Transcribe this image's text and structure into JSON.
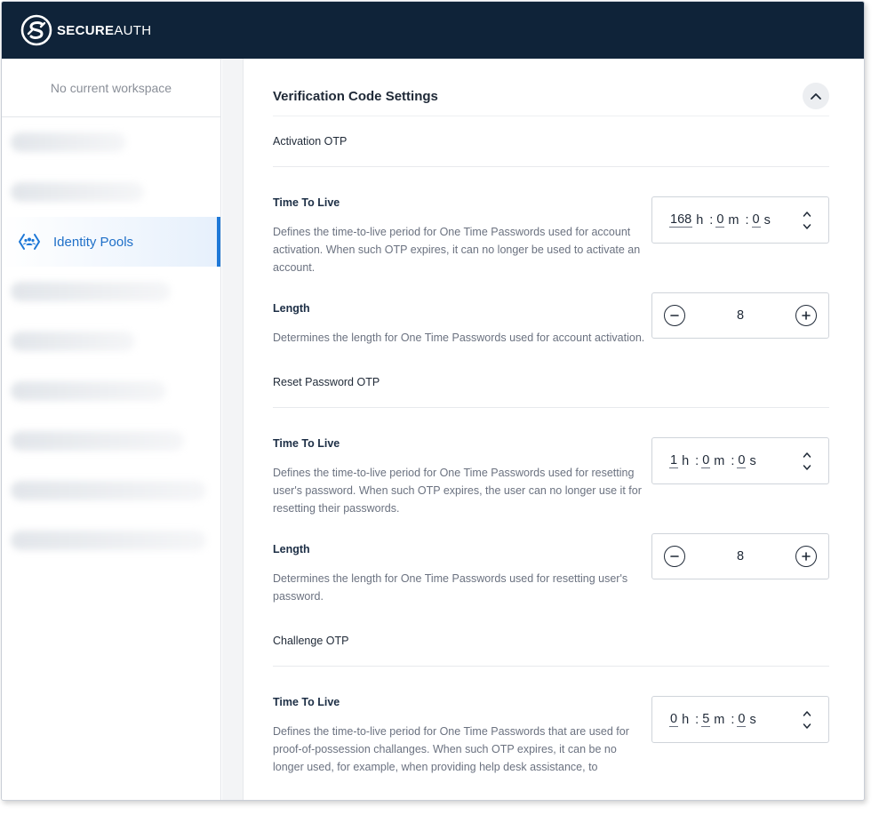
{
  "brand": {
    "bold": "SECURE",
    "light": "AUTH"
  },
  "sidebar": {
    "workspace": "No current workspace",
    "active_item": {
      "label": "Identity Pools",
      "icon": "identity-pools-icon"
    }
  },
  "panel": {
    "title": "Verification Code Settings",
    "sections": [
      {
        "title": "Activation OTP",
        "ttl": {
          "label": "Time To Live",
          "desc": "Defines the time-to-live period for One Time Passwords used for account activation. When such OTP expires, it can no longer be used to activate an account.",
          "h": "168",
          "m": "0",
          "s": "0"
        },
        "length": {
          "label": "Length",
          "desc": "Determines the length for One Time Passwords used for account activation.",
          "value": "8"
        }
      },
      {
        "title": "Reset Password OTP",
        "ttl": {
          "label": "Time To Live",
          "desc": "Defines the time-to-live period for One Time Passwords used for resetting user's password. When such OTP expires, the user can no longer use it for resetting their passwords.",
          "h": "1",
          "m": "0",
          "s": "0"
        },
        "length": {
          "label": "Length",
          "desc": "Determines the length for One Time Passwords used for resetting user's password.",
          "value": "8"
        }
      },
      {
        "title": "Challenge OTP",
        "ttl": {
          "label": "Time To Live",
          "desc": "Defines the time-to-live period for One Time Passwords that are used for proof-of-possession challanges. When such OTP expires, it can be no longer used, for example, when providing help desk assistance, to",
          "h": "0",
          "m": "5",
          "s": "0"
        }
      }
    ]
  },
  "units": {
    "h": "h",
    "m": "m",
    "s": "s",
    "sep": ":"
  },
  "colors": {
    "topbar": "#0f2339",
    "accent": "#1e78d7"
  }
}
